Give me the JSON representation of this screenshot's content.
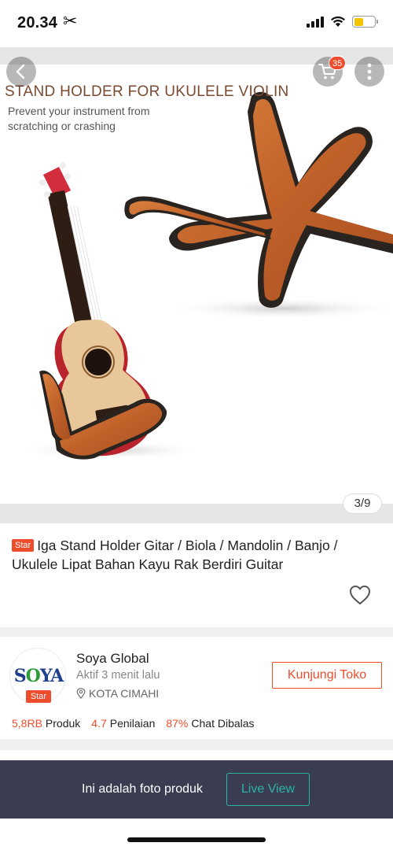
{
  "status_bar": {
    "time": "20.34",
    "scissors_glyph": "✂",
    "icons": [
      "scissors-icon",
      "signal-icon",
      "wifi-icon",
      "battery-icon"
    ],
    "battery_level": 0.45,
    "battery_color": "#f5c400"
  },
  "header": {
    "cart_count": "35",
    "icons": [
      "back-arrow-icon",
      "cart-icon",
      "more-vertical-icon"
    ]
  },
  "product_image": {
    "headline": "STAND HOLDER FOR UKULELE VIOLIN",
    "subtext": "Prevent your instrument from scratching or crashing",
    "counter": "3/9"
  },
  "product": {
    "tag": "Star",
    "title": "Iga Stand Holder Gitar / Biola / Mandolin / Banjo / Ukulele Lipat Bahan Kayu Rak Berdiri Guitar",
    "icons": [
      "heart-icon"
    ]
  },
  "shop": {
    "logo_text": {
      "s": "S",
      "o": "O",
      "ya": "YA"
    },
    "badge": "Star",
    "name": "Soya Global",
    "active": "Aktif 3 menit lalu",
    "location": "KOTA CIMAHI",
    "visit_label": "Kunjungi Toko",
    "stats": [
      {
        "value": "5,8RB",
        "label": "Produk"
      },
      {
        "value": "4.7",
        "label": "Penilaian"
      },
      {
        "value": "87%",
        "label": "Chat Dibalas"
      }
    ],
    "icons": [
      "location-pin-icon"
    ]
  },
  "live_banner": {
    "text": "Ini adalah foto produk",
    "button_label": "Live View"
  },
  "colors": {
    "accent": "#ee4d2d",
    "banner_bg": "#3a3d52",
    "live_teal": "#2bb3a3",
    "wood": "#c8682c"
  }
}
